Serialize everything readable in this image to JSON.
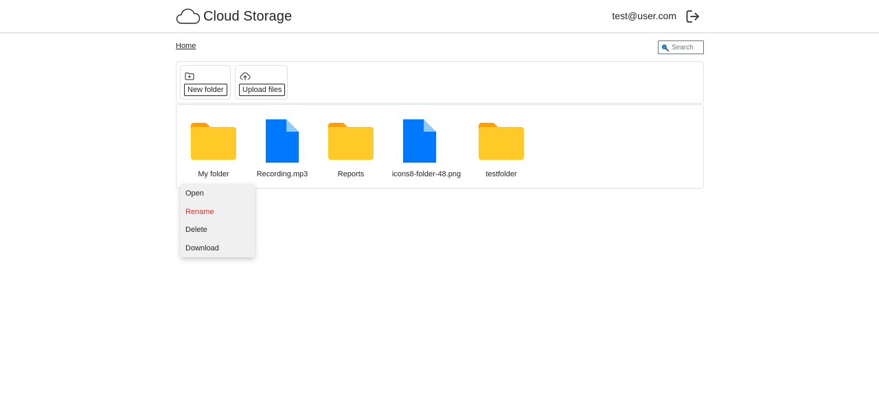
{
  "header": {
    "brand_title": "Cloud Storage",
    "user_email": "test@user.com"
  },
  "icons": {
    "brand": "cloud-icon",
    "logout": "logout-icon",
    "search": "magnifier-icon",
    "new_folder": "folder-plus-icon",
    "upload": "cloud-upload-icon",
    "folder": "folder-icon",
    "file": "file-icon"
  },
  "breadcrumb": {
    "home_label": "Home"
  },
  "search": {
    "placeholder": "Search"
  },
  "actions": {
    "new_folder_label": "New folder",
    "upload_label": "Upload files"
  },
  "files": [
    {
      "name": "My folder",
      "type": "folder"
    },
    {
      "name": "Recording.mp3",
      "type": "file"
    },
    {
      "name": "Reports",
      "type": "folder"
    },
    {
      "name": "icons8-folder-48.png",
      "type": "file"
    },
    {
      "name": "testfolder",
      "type": "folder"
    }
  ],
  "context_menu": {
    "items": [
      {
        "label": "Open",
        "state": "normal"
      },
      {
        "label": "Rename",
        "state": "hover"
      },
      {
        "label": "Delete",
        "state": "normal"
      },
      {
        "label": "Download",
        "state": "normal"
      }
    ]
  },
  "colors": {
    "folder_body": "#FFCA28",
    "folder_tab": "#FFA000",
    "file_body": "#0078FF",
    "file_fold": "#90CAF9",
    "menu_highlight": "#E0302A"
  }
}
